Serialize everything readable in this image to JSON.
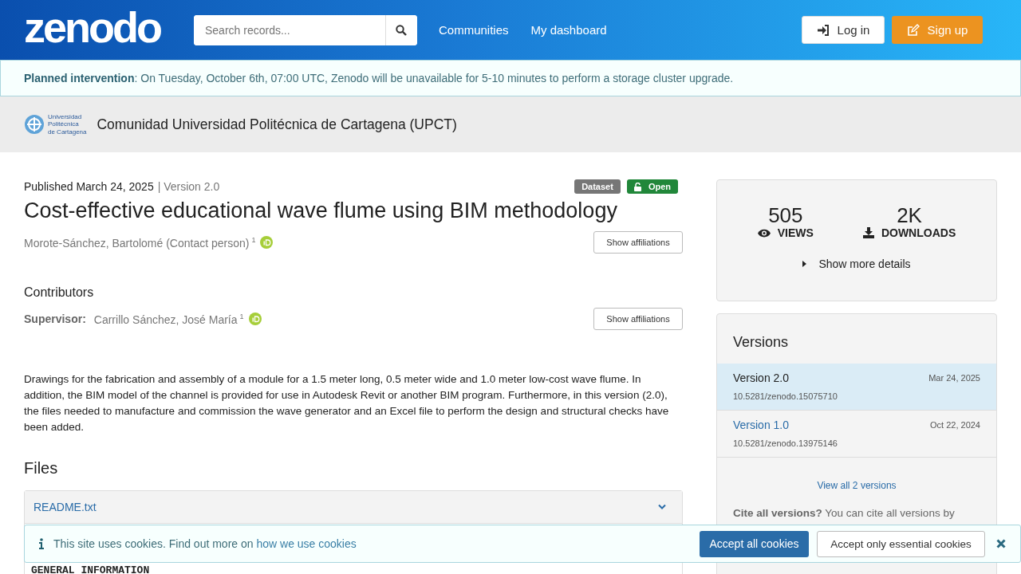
{
  "header": {
    "logo": "zenodo",
    "search": {
      "placeholder": "Search records..."
    },
    "nav": [
      "Communities",
      "My dashboard"
    ],
    "login": "Log in",
    "signup": "Sign up"
  },
  "alert": {
    "label": "Planned intervention",
    "message": ": On Tuesday, October 6th, 07:00 UTC, Zenodo will be unavailable for 5-10 minutes to perform a storage cluster upgrade."
  },
  "community": {
    "logo_lines": [
      "Universidad",
      "Politécnica",
      "de Cartagena"
    ],
    "name": "Comunidad Universidad Politécnica de Cartagena (UPCT)"
  },
  "record": {
    "published": "Published March 24, 2025",
    "version": "| Version 2.0",
    "badges": [
      {
        "label": "Dataset",
        "kind": "type"
      },
      {
        "label": "Open",
        "kind": "access"
      }
    ],
    "title": "Cost-effective educational wave flume using BIM methodology",
    "creators": [
      {
        "name": "Morote-Sánchez, Bartolomé (Contact person)",
        "sup": "1",
        "orcid": true
      }
    ],
    "creators_button": "Show affiliations",
    "contributors_heading": "Contributors",
    "contributors": [
      {
        "role": "Supervisor:",
        "name": "Carrillo Sánchez, José María",
        "sup": "1",
        "orcid": true
      }
    ],
    "contributors_button": "Show affiliations",
    "description": "Drawings for the fabrication and assembly of a module for a 1.5 meter long, 0.5 meter wide and 1.0 meter low-cost wave flume. In addition, the BIM model of the channel is provided for use in Autodesk Revit or another BIM program. Furthermore, in this version (2.0), the files needed to manufacture and commission the wave generator and an Excel file to perform the design and structural checks have been added.",
    "files_heading": "Files",
    "files": [
      {
        "name": "README.txt",
        "expanded": true,
        "preview": "GENERAL INFORMATION"
      }
    ]
  },
  "stats": {
    "items": [
      {
        "value": "505",
        "label": "VIEWS",
        "kind": "views"
      },
      {
        "value": "2K",
        "label": "DOWNLOADS",
        "kind": "downloads"
      }
    ],
    "more": "Show more details"
  },
  "versions": {
    "title": "Versions",
    "items": [
      {
        "label": "Version 2.0",
        "date": "Mar 24, 2025",
        "doi": "10.5281/zenodo.15075710",
        "selected": true
      },
      {
        "label": "Version 1.0",
        "date": "Oct 22, 2024",
        "doi": "10.5281/zenodo.13975146",
        "selected": false
      }
    ],
    "view_all": "View all 2 versions",
    "cite_bold": "Cite all versions?",
    "cite_text": "You can cite all versions by"
  },
  "cookies": {
    "message": "This site uses cookies. Find out more on",
    "link": "how we use cookies",
    "accept_all": "Accept all cookies",
    "accept_essential": "Accept only essential cookies"
  }
}
